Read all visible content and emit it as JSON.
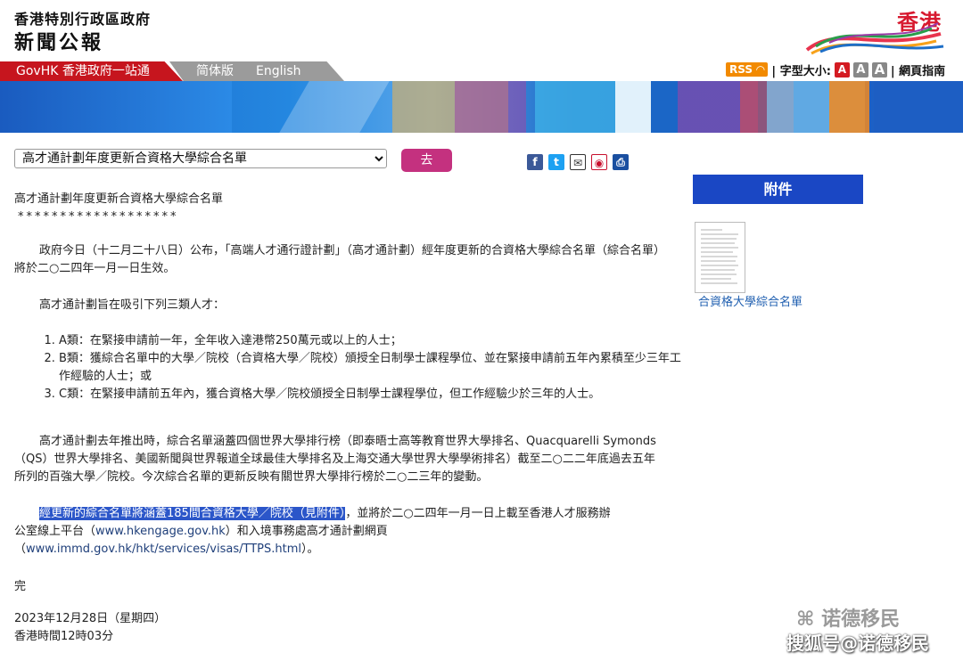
{
  "header": {
    "title_line1": "香港特別行政區政府",
    "title_line2": "新聞公報",
    "brand_text": "香港"
  },
  "nav": {
    "govhk": "GovHK 香港政府一站通",
    "simplified": "简体版",
    "english": "English",
    "rss": "RSS",
    "font_size_label": "| 字型大小:",
    "font_small": "A",
    "font_medium": "A",
    "font_large": "A",
    "guide": "| 網頁指南"
  },
  "controls": {
    "select_value": "高才通計劃年度更新合資格大學綜合名單",
    "go_label": "去"
  },
  "article": {
    "heading": "高才通計劃年度更新合資格大學綜合名單",
    "stars": "*******************",
    "para1": "政府今日（十二月二十八日）公布，「高端人才通行證計劃」（高才通計劃）經年度更新的合資格大學綜合名單（綜合名單）將於二○二四年一月一日生效。",
    "para2": "高才通計劃旨在吸引下列三類人才：",
    "list": [
      "A類：在緊接申請前一年，全年收入達港幣250萬元或以上的人士；",
      "B類：獲綜合名單中的大學／院校（合資格大學／院校）頒授全日制學士課程學位、並在緊接申請前五年內累積至少三年工作經驗的人士；或",
      "C類：在緊接申請前五年內，獲合資格大學／院校頒授全日制學士課程學位，但工作經驗少於三年的人士。"
    ],
    "para3": "高才通計劃去年推出時，綜合名單涵蓋四個世界大學排行榜（即泰晤士高等教育世界大學排名、Quacquarelli Symonds（QS）世界大學排名、美國新聞與世界報道全球最佳大學排名及上海交通大學世界大學學術排名）截至二○二二年底過去五年所列的百強大學／院校。今次綜合名單的更新反映有關世界大學排行榜於二○二三年的變動。",
    "para4_highlight": "經更新的綜合名單將涵蓋185間合資格大學／院校（見附件）",
    "para4_rest1": "，並將於二○二四年一月一日上載至香港人才服務辦",
    "para4_line2a": "公室線上平台（",
    "para4_link1": "www.hkengage.gov.hk",
    "para4_line2b": "）和入境事務處高才通計劃網頁",
    "para4_line3a": "（",
    "para4_link2": "www.immd.gov.hk/hkt/services/visas/TTPS.html",
    "para4_line3b": "）。",
    "end": "完",
    "date": "2023年12月28日（星期四）",
    "time": "香港時間12時03分"
  },
  "sidebar": {
    "attachment_header": "附件",
    "attachment_link": "合資格大學綜合名單"
  },
  "watermark": {
    "line1": "诺德移民",
    "line2": "搜狐号@诺德移民"
  }
}
